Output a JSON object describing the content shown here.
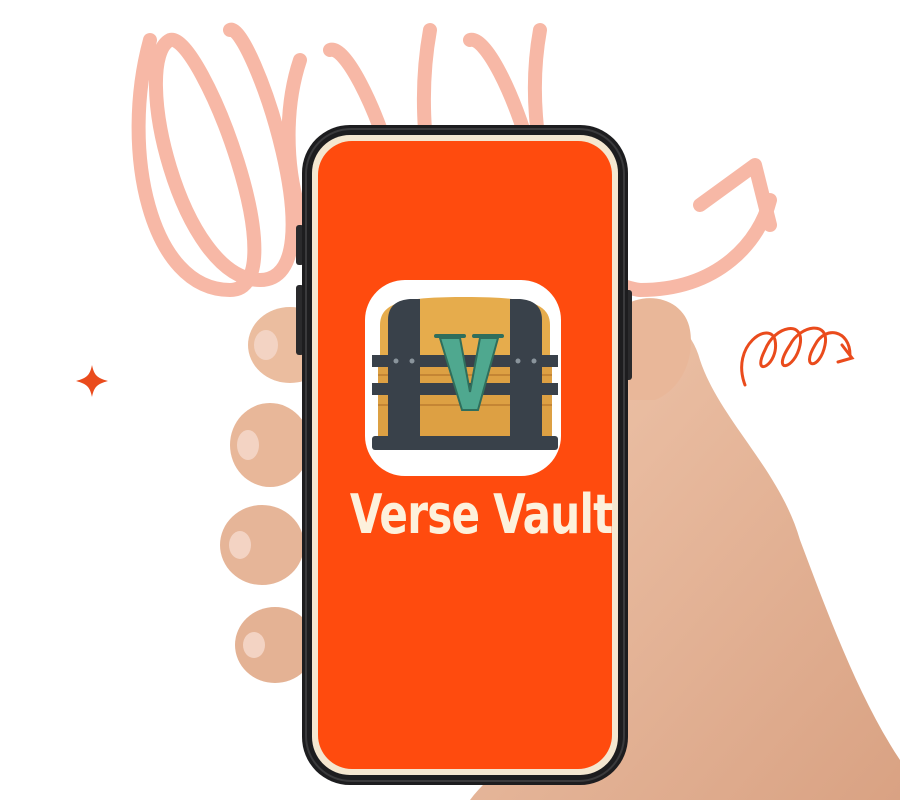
{
  "app": {
    "name": "Verse Vault",
    "icon": "treasure-chest-icon",
    "icon_letter": "V"
  },
  "colors": {
    "screen_background": "#ff4b0e",
    "title_text": "#fdf1dc",
    "decor_swirl": "#f7b8a6",
    "decor_accent": "#ea4b1c",
    "phone_body": "#1d1d1f",
    "skin": "#e6b598"
  }
}
